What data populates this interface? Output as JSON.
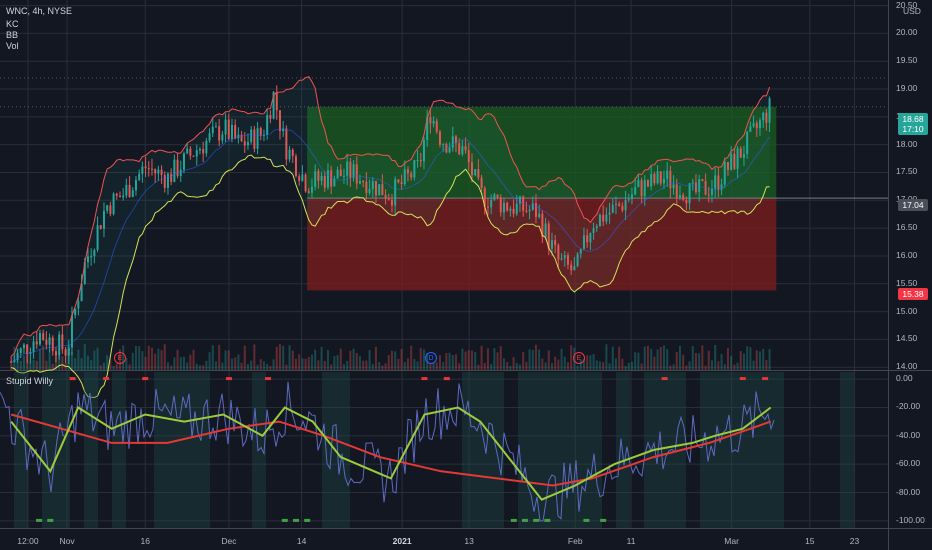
{
  "header": {
    "symbol": "WNC, 4h, NYSE",
    "indicators": [
      "KC",
      "BB",
      "Vol"
    ],
    "currency": "USD"
  },
  "lower_pane": {
    "title": "Stupid Willy"
  },
  "price_labels": {
    "last": "18.68",
    "countdown": "17:10",
    "entry": "17.04",
    "stop": "15.38"
  },
  "events": [
    {
      "label": "E",
      "color": "#f23645"
    },
    {
      "label": "D",
      "color": "#2962ff"
    },
    {
      "label": "E",
      "color": "#f23645"
    }
  ],
  "colors": {
    "background": "#131722",
    "up": "#26a69a",
    "down": "#ef5350",
    "bb_upper": "#ef5350",
    "bb_lower": "#d4e157",
    "target_zone": "#1b5e20",
    "stop_zone": "#7f1d1d",
    "oscillator": "#5c6bc0",
    "osc_fast": "#9ccc3c",
    "osc_slow": "#e53935"
  },
  "chart_data": [
    {
      "type": "candlestick",
      "title": "WNC, 4h, NYSE",
      "y_axis_ticks": [
        "20.50",
        "20.00",
        "19.50",
        "19.00",
        "18.50",
        "18.00",
        "17.50",
        "17.00",
        "16.50",
        "16.00",
        "15.50",
        "15.00",
        "14.50",
        "14.00"
      ],
      "x_axis_ticks": [
        "12:00",
        "Nov",
        "16",
        "Dec",
        "14",
        "2021",
        "13",
        "Feb",
        "11",
        "Mar",
        "15",
        "23"
      ],
      "ylim": [
        13.95,
        20.6
      ],
      "position_tool": {
        "target": 18.68,
        "entry": 17.04,
        "stop": 15.38
      },
      "close_path": [
        [
          "2020-10-23",
          14.1
        ],
        [
          "2020-10-28",
          14.6
        ],
        [
          "2020-11-02",
          14.3
        ],
        [
          "2020-11-05",
          15.8
        ],
        [
          "2020-11-09",
          16.9
        ],
        [
          "2020-11-12",
          17.1
        ],
        [
          "2020-11-16",
          17.6
        ],
        [
          "2020-11-20",
          17.4
        ],
        [
          "2020-11-25",
          17.9
        ],
        [
          "2020-11-30",
          18.3
        ],
        [
          "2020-12-03",
          18.0
        ],
        [
          "2020-12-07",
          18.2
        ],
        [
          "2020-12-09",
          18.9
        ],
        [
          "2020-12-11",
          18.0
        ],
        [
          "2020-12-15",
          17.3
        ],
        [
          "2020-12-18",
          17.4
        ],
        [
          "2020-12-23",
          17.5
        ],
        [
          "2020-12-30",
          17.1
        ],
        [
          "2021-01-04",
          17.6
        ],
        [
          "2021-01-06",
          18.6
        ],
        [
          "2021-01-08",
          18.1
        ],
        [
          "2021-01-12",
          17.9
        ],
        [
          "2021-01-15",
          17.1
        ],
        [
          "2021-01-20",
          16.9
        ],
        [
          "2021-01-25",
          16.8
        ],
        [
          "2021-01-29",
          15.9
        ],
        [
          "2021-02-01",
          15.7
        ],
        [
          "2021-02-04",
          16.6
        ],
        [
          "2021-02-09",
          16.9
        ],
        [
          "2021-02-12",
          17.2
        ],
        [
          "2021-02-17",
          17.4
        ],
        [
          "2021-02-22",
          17.1
        ],
        [
          "2021-02-26",
          17.3
        ],
        [
          "2021-03-03",
          17.9
        ],
        [
          "2021-03-08",
          18.68
        ]
      ]
    },
    {
      "type": "line",
      "title": "Stupid Willy",
      "y_axis_ticks": [
        "0.00",
        "-20.00",
        "-40.00",
        "-60.00",
        "-80.00",
        "-100.00"
      ],
      "ylim": [
        -105,
        5
      ],
      "series": [
        {
          "values": [
            [
              "2020-10-23",
              -30
            ],
            [
              "2020-10-30",
              -65
            ],
            [
              "2020-11-04",
              -20
            ],
            [
              "2020-11-10",
              -35
            ],
            [
              "2020-11-16",
              -25
            ],
            [
              "2020-11-23",
              -30
            ],
            [
              "2020-11-30",
              -25
            ],
            [
              "2020-12-07",
              -40
            ],
            [
              "2020-12-11",
              -20
            ],
            [
              "2020-12-16",
              -30
            ],
            [
              "2020-12-21",
              -55
            ],
            [
              "2020-12-30",
              -70
            ],
            [
              "2021-01-05",
              -25
            ],
            [
              "2021-01-11",
              -20
            ],
            [
              "2021-01-15",
              -30
            ],
            [
              "2021-01-20",
              -55
            ],
            [
              "2021-01-26",
              -85
            ],
            [
              "2021-02-01",
              -75
            ],
            [
              "2021-02-08",
              -60
            ],
            [
              "2021-02-15",
              -50
            ],
            [
              "2021-02-22",
              -45
            ],
            [
              "2021-02-26",
              -40
            ],
            [
              "2021-03-03",
              -35
            ],
            [
              "2021-03-08",
              -20
            ]
          ]
        },
        {
          "values": [
            [
              "2020-10-23",
              -25
            ],
            [
              "2020-11-01",
              -35
            ],
            [
              "2020-11-10",
              -45
            ],
            [
              "2020-11-20",
              -45
            ],
            [
              "2020-12-01",
              -35
            ],
            [
              "2020-12-10",
              -30
            ],
            [
              "2020-12-18",
              -40
            ],
            [
              "2020-12-28",
              -55
            ],
            [
              "2021-01-08",
              -65
            ],
            [
              "2021-01-18",
              -70
            ],
            [
              "2021-01-28",
              -75
            ],
            [
              "2021-02-04",
              -70
            ],
            [
              "2021-02-15",
              -55
            ],
            [
              "2021-02-25",
              -45
            ],
            [
              "2021-03-08",
              -30
            ]
          ]
        }
      ]
    }
  ]
}
